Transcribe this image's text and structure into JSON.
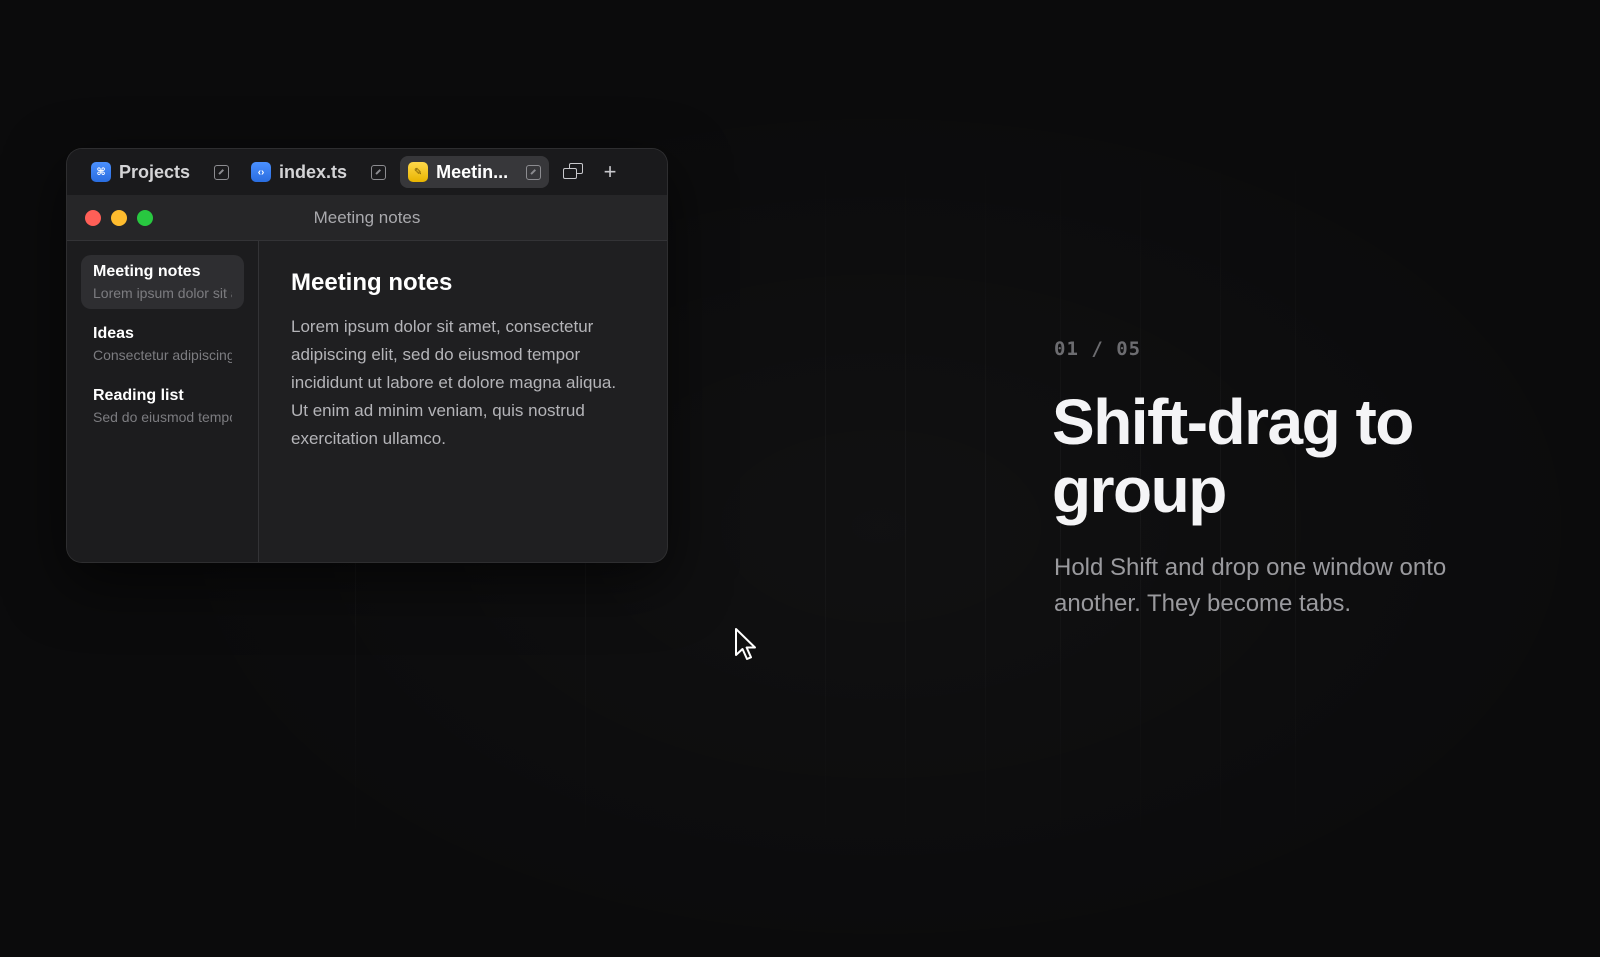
{
  "tabs": [
    {
      "label": "Projects",
      "icon": "command-icon",
      "icon_glyph": "⌘",
      "active": false
    },
    {
      "label": "index.ts",
      "icon": "code-icon",
      "icon_glyph": "‹›",
      "active": false
    },
    {
      "label": "Meetin...",
      "icon": "notes-icon",
      "icon_glyph": "✎",
      "active": true
    }
  ],
  "window": {
    "title": "Meeting notes"
  },
  "sidebar": {
    "items": [
      {
        "title": "Meeting notes",
        "subtitle": "Lorem ipsum dolor sit amet",
        "active": true
      },
      {
        "title": "Ideas",
        "subtitle": "Consectetur adipiscing",
        "active": false
      },
      {
        "title": "Reading list",
        "subtitle": "Sed do eiusmod tempor",
        "active": false
      }
    ]
  },
  "document": {
    "heading": "Meeting notes",
    "body": "Lorem ipsum dolor sit amet, consectetur adipiscing elit, sed do eiusmod tempor incididunt ut labore et dolore magna aliqua. Ut enim ad minim veniam, quis nostrud exercitation ullamco."
  },
  "onboarding": {
    "step": "01 / 05",
    "headline": "Shift-drag to group",
    "description": "Hold Shift and drop one window onto another. They become tabs."
  },
  "colors": {
    "background": "#0b0b0c",
    "window": "#1f1f21",
    "accent_blue": "#2a6de0",
    "accent_yellow": "#e8b400"
  }
}
